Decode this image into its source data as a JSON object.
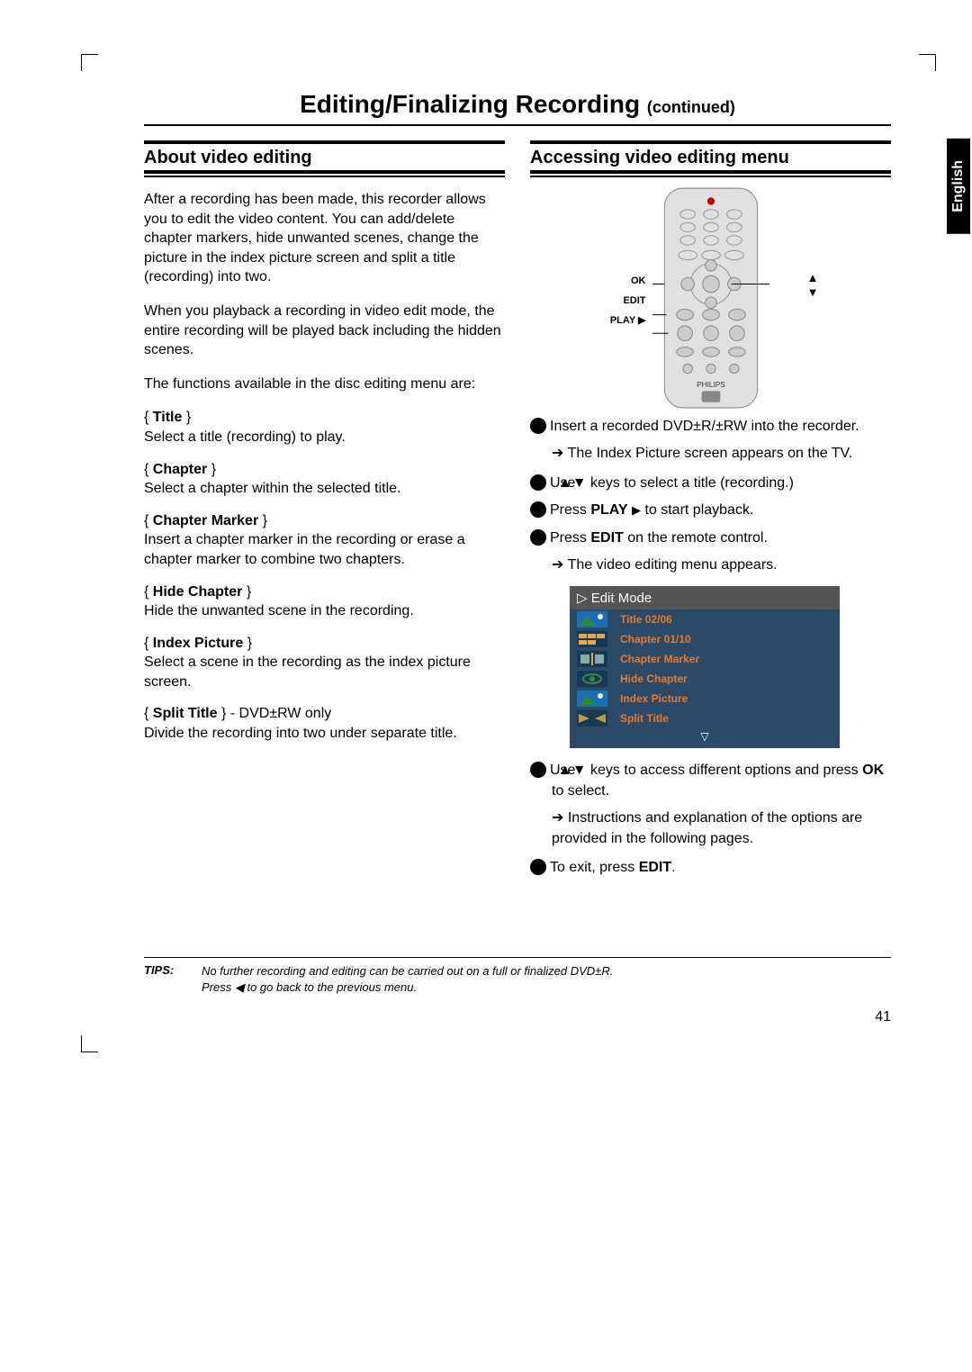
{
  "page_title_main": "Editing/Finalizing Recording ",
  "page_title_sub": "(continued)",
  "language_tab": "English",
  "left": {
    "heading": "About video editing",
    "intro": "After a recording has been made, this recorder allows you to edit the video content. You can add/delete chapter markers, hide unwanted scenes, change the picture in the index picture screen and split a title (recording) into two.",
    "playback_note": "When you playback a recording in video edit mode, the entire recording will be played back including the hidden scenes.",
    "functions_intro": "The functions available in the disc editing menu are:",
    "functions": [
      {
        "name": "Title",
        "desc": "Select a title (recording) to play."
      },
      {
        "name": "Chapter",
        "desc": "Select a chapter within the selected title."
      },
      {
        "name": "Chapter Marker",
        "desc": "Insert a chapter marker in the recording or erase a chapter marker to combine two chapters."
      },
      {
        "name": "Hide Chapter",
        "desc": "Hide the unwanted scene in the recording."
      },
      {
        "name": "Index Picture",
        "desc": "Select a scene in the recording as the index picture screen."
      },
      {
        "name": "Split Title",
        "suffix": " - DVD±RW only",
        "desc": "Divide the recording into two under separate title."
      }
    ]
  },
  "right": {
    "heading": "Accessing video editing menu",
    "remote_labels": {
      "ok": "OK",
      "edit": "EDIT",
      "play": "PLAY ▶"
    },
    "remote_brand": "PHILIPS",
    "steps": {
      "s1": "Insert a recorded DVD±R/±RW into the recorder.",
      "s1_sub": "The Index Picture screen appears on the TV.",
      "s2_pre": "Use ",
      "s2_post": " keys to select a title (recording.)",
      "s3_pre": "Press ",
      "s3_bold": "PLAY",
      "s3_post": " to start playback.",
      "s4_pre": "Press ",
      "s4_bold": "EDIT",
      "s4_post": " on the remote control.",
      "s4_sub": "The video editing menu appears.",
      "s5_pre": "Use ",
      "s5_mid": " keys to access different options and press ",
      "s5_bold": "OK",
      "s5_post": " to select.",
      "s5_sub": "Instructions and explanation of the options are provided in the following pages.",
      "s6_pre": "To exit, press ",
      "s6_bold": "EDIT",
      "s6_post": "."
    },
    "edit_panel": {
      "header": "Edit Mode",
      "items": [
        "Title 02/06",
        "Chapter 01/10",
        "Chapter Marker",
        "Hide Chapter",
        "Index Picture",
        "Split Title"
      ]
    }
  },
  "tips": {
    "label": "TIPS:",
    "line1": "No further recording and editing can be carried out on a full or finalized DVD±R.",
    "line2_pre": "Press ",
    "line2_post": " to go back to the previous menu."
  },
  "page_number": "41"
}
